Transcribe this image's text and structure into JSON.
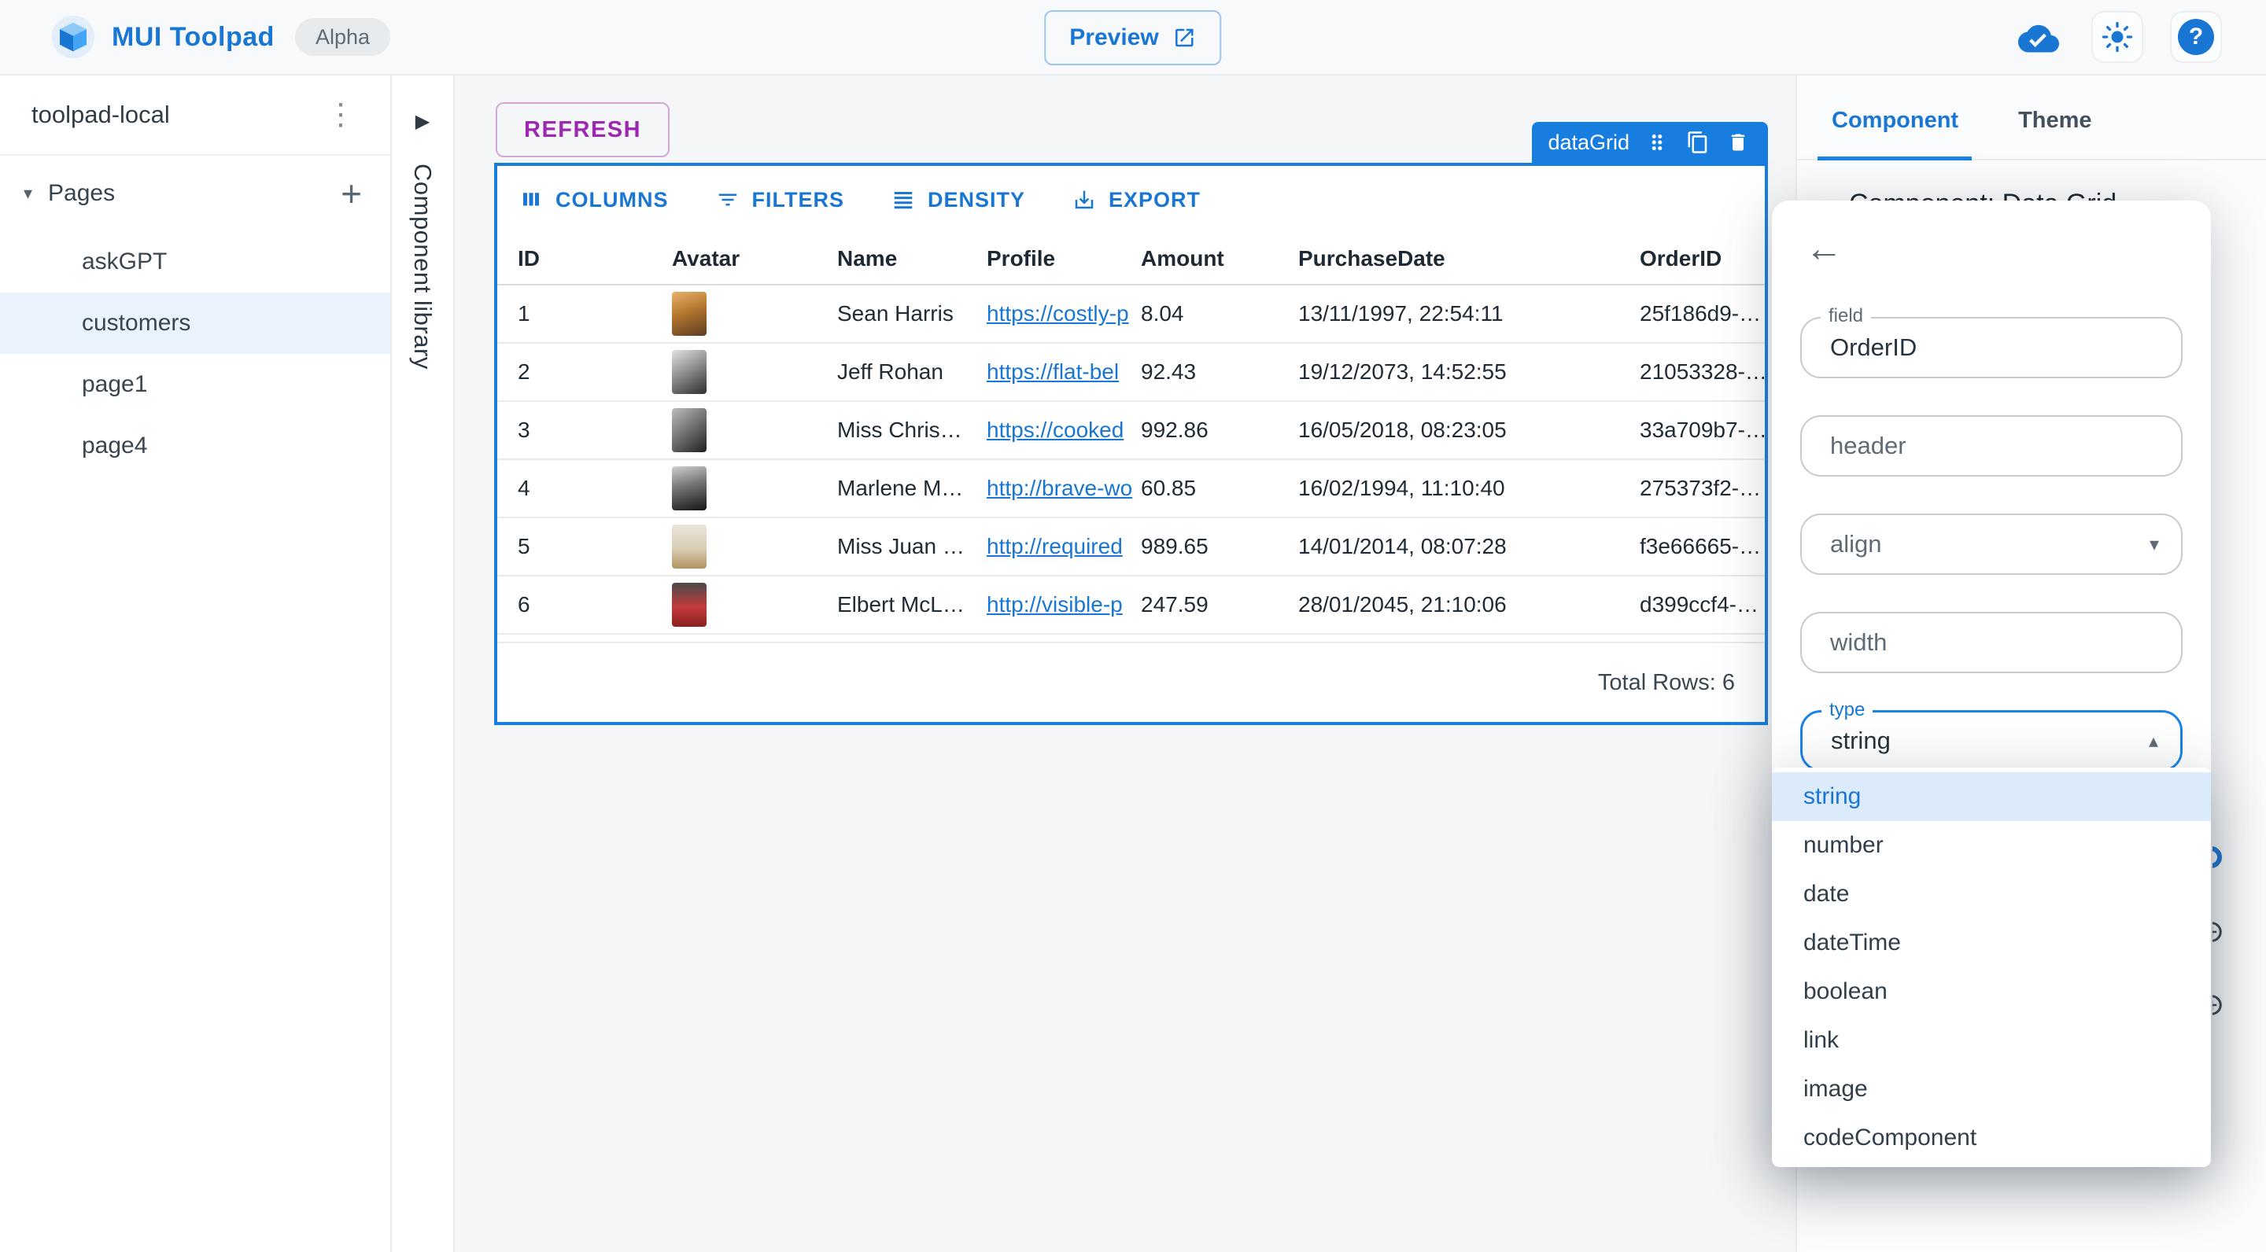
{
  "topbar": {
    "app_title": "MUI Toolpad",
    "badge": "Alpha",
    "preview_label": "Preview"
  },
  "sidebar": {
    "project_name": "toolpad-local",
    "section_label": "Pages",
    "pages": [
      {
        "label": "askGPT",
        "selected": false
      },
      {
        "label": "customers",
        "selected": true
      },
      {
        "label": "page1",
        "selected": false
      },
      {
        "label": "page4",
        "selected": false
      }
    ]
  },
  "component_library": {
    "label": "Component library"
  },
  "canvas": {
    "refresh_label": "REFRESH",
    "selection_chip_label": "dataGrid"
  },
  "grid": {
    "toolbar": {
      "columns": {
        "label": "COLUMNS"
      },
      "filters": {
        "label": "FILTERS"
      },
      "density": {
        "label": "DENSITY"
      },
      "export": {
        "label": "EXPORT"
      }
    },
    "columns": [
      "ID",
      "Avatar",
      "Name",
      "Profile",
      "Amount",
      "PurchaseDate",
      "OrderID"
    ],
    "rows": [
      {
        "id": "1",
        "avatar_tone": "warm",
        "name": "Sean Harris",
        "profile": "https://costly-p",
        "amount": "8.04",
        "purchase_date": "13/11/1997, 22:54:11",
        "order_id": "25f186d9-…"
      },
      {
        "id": "2",
        "avatar_tone": "mono-light",
        "name": "Jeff Rohan",
        "profile": "https://flat-bel",
        "amount": "92.43",
        "purchase_date": "19/12/2073, 14:52:55",
        "order_id": "21053328-…"
      },
      {
        "id": "3",
        "avatar_tone": "mono-group",
        "name": "Miss Chris…",
        "profile": "https://cooked",
        "amount": "992.86",
        "purchase_date": "16/05/2018, 08:23:05",
        "order_id": "33a709b7-…"
      },
      {
        "id": "4",
        "avatar_tone": "mono-face",
        "name": "Marlene M…",
        "profile": "http://brave-wo",
        "amount": "60.85",
        "purchase_date": "16/02/1994, 11:10:40",
        "order_id": "275373f2-…"
      },
      {
        "id": "5",
        "avatar_tone": "beach",
        "name": "Miss Juan …",
        "profile": "http://required",
        "amount": "989.65",
        "purchase_date": "14/01/2014, 08:07:28",
        "order_id": "f3e66665-…"
      },
      {
        "id": "6",
        "avatar_tone": "red-shirt",
        "name": "Elbert McL…",
        "profile": "http://visible-p",
        "amount": "247.59",
        "purchase_date": "28/01/2045, 21:10:06",
        "order_id": "d399ccf4-…"
      }
    ],
    "footer_total": "Total Rows: 6"
  },
  "inspector": {
    "tabs": {
      "component": "Component",
      "theme": "Theme"
    },
    "heading": "Component: Data Grid",
    "popover": {
      "field_label": "field",
      "field_value": "OrderID",
      "header_label": "header",
      "align_label": "align",
      "width_label": "width",
      "type_label": "type",
      "type_value": "string"
    },
    "type_menu": {
      "options": [
        {
          "label": "string",
          "selected": true
        },
        {
          "label": "number",
          "selected": false
        },
        {
          "label": "date",
          "selected": false
        },
        {
          "label": "dateTime",
          "selected": false
        },
        {
          "label": "boolean",
          "selected": false
        },
        {
          "label": "link",
          "selected": false
        },
        {
          "label": "image",
          "selected": false
        },
        {
          "label": "codeComponent",
          "selected": false
        }
      ]
    }
  },
  "icons": {
    "kebab": "⋮",
    "caret_down": "▾",
    "plus": "+",
    "chevron_right": "▶",
    "back_arrow": "←",
    "select_down": "▾",
    "select_up": "▴",
    "help": "?"
  },
  "colors": {
    "primary": "#1976d2",
    "selection_blue": "#177ee0",
    "purple_accent": "#9c27b0",
    "selected_page_bg": "#e9f2fd",
    "menu_selected_bg": "#dcebfc"
  }
}
